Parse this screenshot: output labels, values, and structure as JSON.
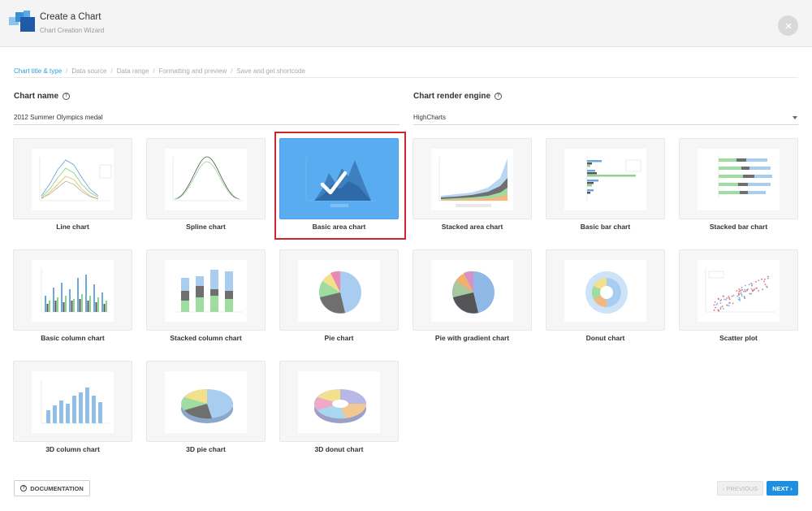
{
  "header": {
    "title": "Create a Chart",
    "subtitle": "Chart Creation Wizard",
    "accent": "#2a9fd8"
  },
  "steps": [
    {
      "label": "Chart title & type",
      "active": true
    },
    {
      "label": "Data source",
      "active": false
    },
    {
      "label": "Data range",
      "active": false
    },
    {
      "label": "Formatting and preview",
      "active": false
    },
    {
      "label": "Save and get shortcode",
      "active": false
    }
  ],
  "step_separator": "/",
  "form": {
    "chart_name_label": "Chart name",
    "chart_name_value": "2012 Summer Olympics medal",
    "render_engine_label": "Chart render engine",
    "render_engine_value": "HighCharts",
    "help_glyph": "?"
  },
  "charts": [
    {
      "label": "Line chart",
      "selected": false
    },
    {
      "label": "Spline chart",
      "selected": false
    },
    {
      "label": "Basic area chart",
      "selected": true
    },
    {
      "label": "Stacked area chart",
      "selected": false
    },
    {
      "label": "Basic bar chart",
      "selected": false
    },
    {
      "label": "Stacked bar chart",
      "selected": false
    },
    {
      "label": "Basic column chart",
      "selected": false
    },
    {
      "label": "Stacked column chart",
      "selected": false
    },
    {
      "label": "Pie chart",
      "selected": false
    },
    {
      "label": "Pie with gradient chart",
      "selected": false
    },
    {
      "label": "Donut chart",
      "selected": false
    },
    {
      "label": "Scatter plot",
      "selected": false
    },
    {
      "label": "3D column chart",
      "selected": false
    },
    {
      "label": "3D pie chart",
      "selected": false
    },
    {
      "label": "3D donut chart",
      "selected": false
    }
  ],
  "footer": {
    "documentation_label": "DOCUMENTATION",
    "previous_label": "‹ PREVIOUS",
    "next_label": "NEXT ›"
  },
  "icons": {
    "close": "close-icon",
    "help": "help-icon",
    "check": "checkmark-icon"
  }
}
